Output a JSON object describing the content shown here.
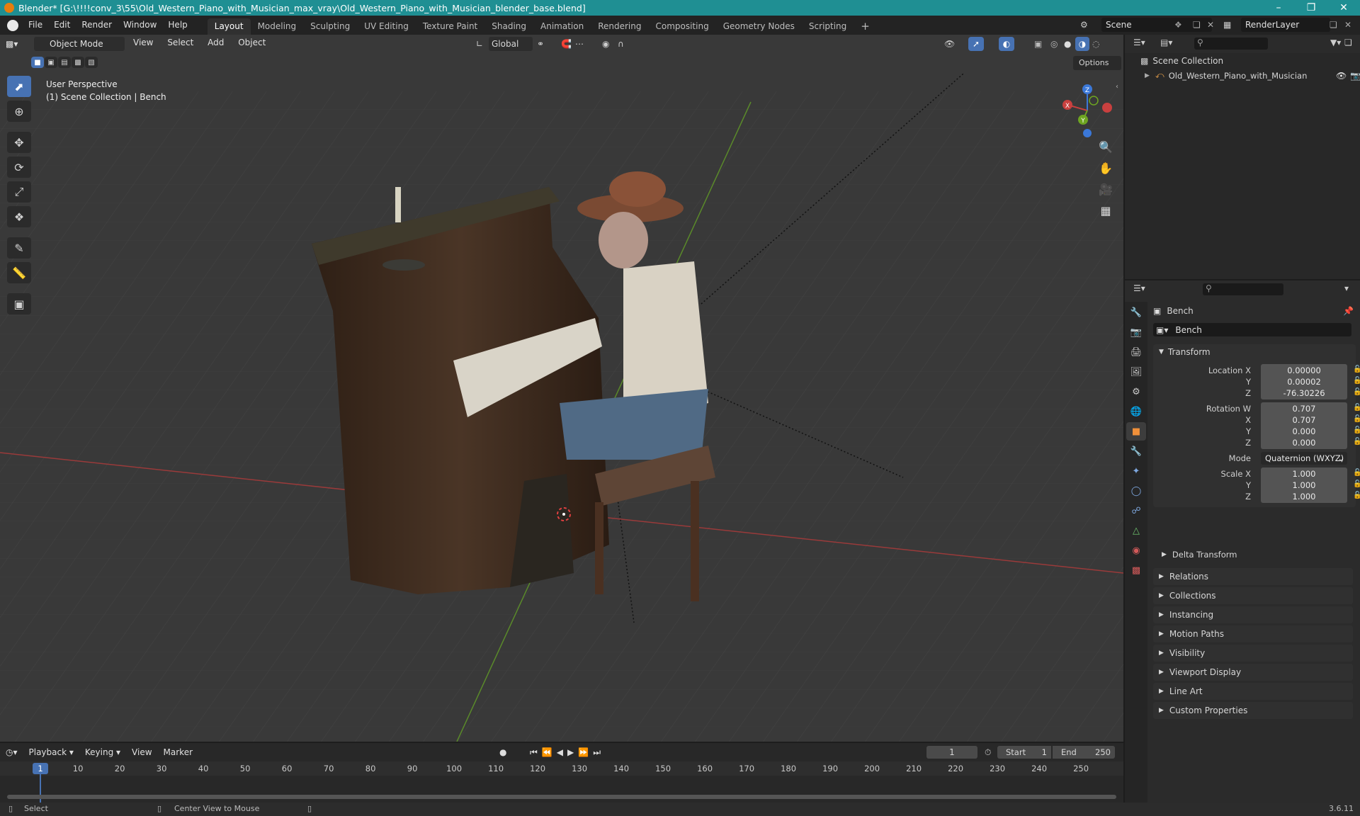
{
  "title_bar": {
    "title": "Blender* [G:\\!!!!conv_3\\55\\Old_Western_Piano_with_Musician_max_vray\\Old_Western_Piano_with_Musician_blender_base.blend]"
  },
  "menu": [
    "File",
    "Edit",
    "Render",
    "Window",
    "Help"
  ],
  "workspaces": [
    "Layout",
    "Modeling",
    "Sculpting",
    "UV Editing",
    "Texture Paint",
    "Shading",
    "Animation",
    "Rendering",
    "Compositing",
    "Geometry Nodes",
    "Scripting"
  ],
  "active_workspace": "Layout",
  "scene": {
    "name": "Scene",
    "view_layer": "RenderLayer"
  },
  "viewport": {
    "mode": "Object Mode",
    "menus": [
      "View",
      "Select",
      "Add",
      "Object"
    ],
    "orientation": "Global",
    "options_label": "Options",
    "overlay_line1": "User Perspective",
    "overlay_line2": "(1) Scene Collection | Bench",
    "gizmo": {
      "x": "X",
      "y": "Y",
      "z": "Z"
    }
  },
  "outliner": {
    "root": "Scene Collection",
    "items": [
      {
        "name": "Old_Western_Piano_with_Musician"
      }
    ]
  },
  "properties": {
    "object_name": "Bench",
    "data_name": "Bench",
    "transform_title": "Transform",
    "location": {
      "label": "Location X",
      "x": "0.00000",
      "y": "0.00002",
      "z": "-76.30226"
    },
    "rotation": {
      "label": "Rotation W",
      "w": "0.707",
      "x": "0.707",
      "y": "0.000",
      "z": "0.000"
    },
    "mode_label": "Mode",
    "mode_value": "Quaternion (WXYZ)",
    "scale": {
      "label": "Scale X",
      "x": "1.000",
      "y": "1.000",
      "z": "1.000"
    },
    "axis_labels": {
      "x": "X",
      "y": "Y",
      "z": "Z"
    },
    "delta_transform": "Delta Transform",
    "panels": [
      "Relations",
      "Collections",
      "Instancing",
      "Motion Paths",
      "Visibility",
      "Viewport Display",
      "Line Art",
      "Custom Properties"
    ]
  },
  "timeline": {
    "menus": [
      "Playback",
      "Keying",
      "View",
      "Marker"
    ],
    "current_frame": "1",
    "start_label": "Start",
    "start": "1",
    "end_label": "End",
    "end": "250",
    "ruler": [
      "1",
      "10",
      "20",
      "30",
      "40",
      "50",
      "60",
      "70",
      "80",
      "90",
      "100",
      "110",
      "120",
      "130",
      "140",
      "150",
      "160",
      "170",
      "180",
      "190",
      "200",
      "210",
      "220",
      "230",
      "240",
      "250"
    ]
  },
  "status": {
    "select": "Select",
    "center": "Center View to Mouse",
    "version": "3.6.11"
  },
  "colors": {
    "accent": "#4772b3",
    "titlebar": "#1f8f93",
    "x_axis": "#c9403f",
    "y_axis": "#6ea521",
    "z_axis": "#3b78d8"
  }
}
